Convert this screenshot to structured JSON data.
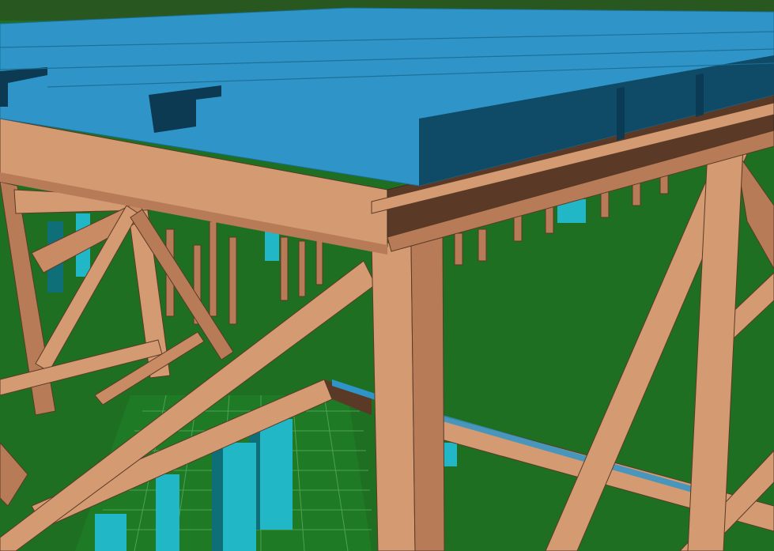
{
  "viewport": {
    "label": "",
    "colors": {
      "ground_green": "#1f6f22",
      "ground_green_light": "#2a7f2c",
      "grid_line": "#58a85c",
      "slab_top": "#2f95c8",
      "slab_side": "#0f4a66",
      "slab_side_dark": "#0b3a52",
      "column_cyan": "#21b7c7",
      "column_cyan_dark": "#0f6f78",
      "timber_light": "#d49a72",
      "timber_mid": "#b77c57",
      "timber_dark": "#5a3a27"
    },
    "icons": []
  }
}
